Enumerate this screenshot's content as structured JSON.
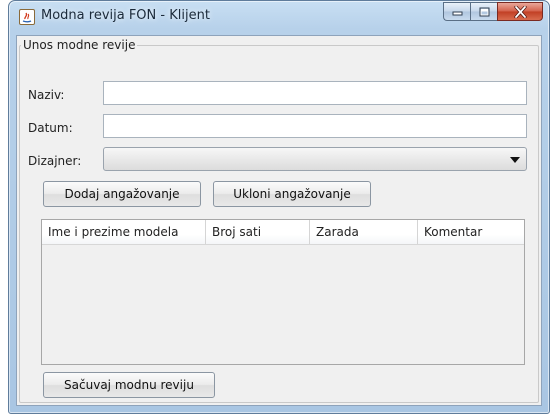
{
  "window": {
    "title": "Modna revija FON - Klijent"
  },
  "form": {
    "legend": "Unos modne revije",
    "naziv_label": "Naziv:",
    "naziv_value": "",
    "datum_label": "Datum:",
    "datum_value": "",
    "dizajner_label": "Dizajner:",
    "dizajner_selected": ""
  },
  "buttons": {
    "add": "Dodaj angažovanje",
    "remove": "Ukloni angažovanje",
    "save": "Sačuvaj modnu reviju"
  },
  "table": {
    "columns": [
      "Ime i prezime modela",
      "Broj sati",
      "Zarada",
      "Komentar"
    ],
    "rows": []
  },
  "icons": {
    "app": "java-app-icon",
    "minimize": "minimize-icon",
    "maximize": "maximize-icon",
    "close": "close-icon",
    "combo": "chevron-down-icon"
  }
}
